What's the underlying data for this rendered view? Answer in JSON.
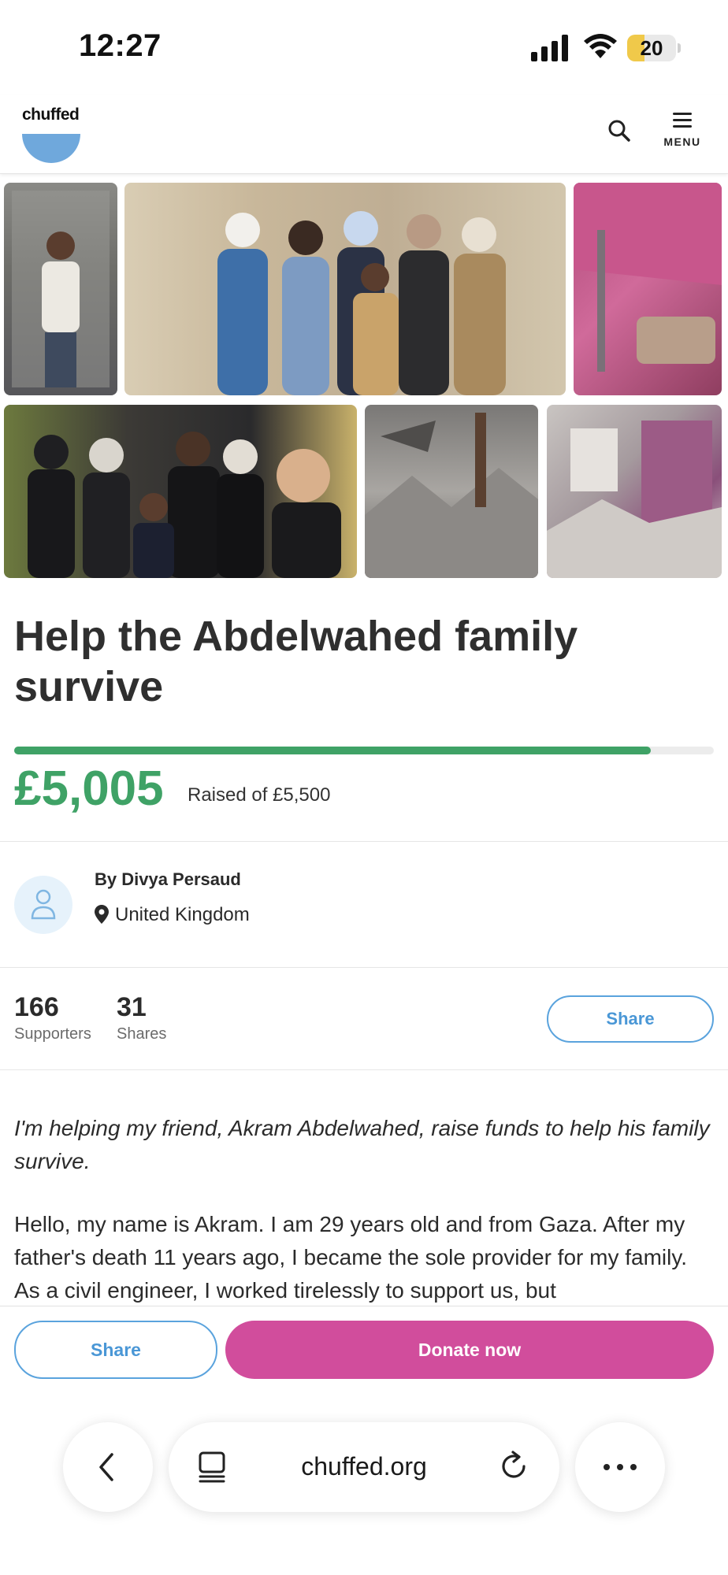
{
  "status_bar": {
    "time": "12:27",
    "battery": "20"
  },
  "header": {
    "logo_text": "chuffed",
    "menu_label": "MENU"
  },
  "campaign": {
    "title": "Help the Abdelwahed family survive",
    "raised_amount": "£5,005",
    "raised_of": "Raised of £5,500",
    "progress_fraction": 0.91
  },
  "organiser": {
    "name": "By Divya Persaud",
    "location": "United Kingdom"
  },
  "stats": {
    "supporters_count": "166",
    "supporters_label": "Supporters",
    "shares_count": "31",
    "shares_label": "Shares",
    "share_button": "Share"
  },
  "story": {
    "intro": "I'm helping my friend, Akram Abdelwahed, raise funds to help his family survive.",
    "body": "Hello, my name is Akram. I am 29 years old and from Gaza. After my father's death 11 years ago, I became the sole provider for my family. As a civil engineer, I worked tirelessly to support us, but"
  },
  "actions": {
    "share_label": "Share",
    "donate_label": "Donate now"
  },
  "browser": {
    "url": "chuffed.org"
  },
  "colors": {
    "accent_green": "#3fa266",
    "donate_pink": "#d14d9c",
    "share_blue": "#4a97d6"
  }
}
